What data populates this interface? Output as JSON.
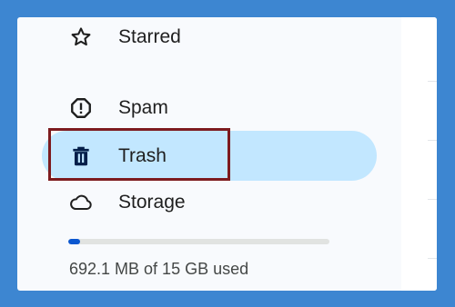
{
  "sidebar": {
    "items": [
      {
        "label": "Starred",
        "icon": "star-icon"
      },
      {
        "label": "Spam",
        "icon": "spam-icon"
      },
      {
        "label": "Trash",
        "icon": "trash-icon",
        "selected": true
      },
      {
        "label": "Storage",
        "icon": "cloud-icon"
      }
    ]
  },
  "storage": {
    "usage_text": "692.1 MB of 15 GB used",
    "used_fraction": 0.045
  },
  "colors": {
    "background": "#3d86d1",
    "panel": "#f8fafd",
    "selected_item": "#c2e7ff",
    "highlight_border": "#7d1b1f",
    "storage_fill": "#0b57d0",
    "storage_track": "#e1e3e1"
  }
}
